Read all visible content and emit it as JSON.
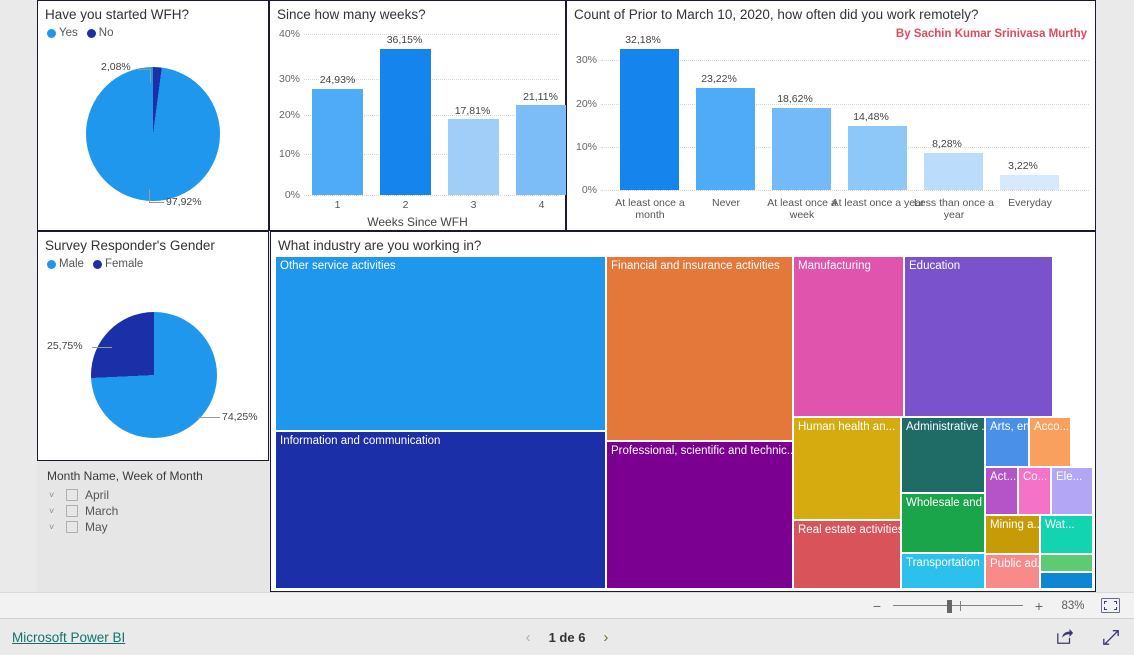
{
  "report": {
    "attribution": "By Sachin Kumar Srinivasa Murthy"
  },
  "panels": {
    "wfh_started": {
      "title": "Have you started WFH?"
    },
    "weeks": {
      "title": "Since how many weeks?"
    },
    "remote_freq": {
      "title": "Count of Prior to March 10, 2020, how often did you work remotely?"
    },
    "gender": {
      "title": "Survey Responder's Gender"
    },
    "industry": {
      "title": "What industry are you working in?"
    }
  },
  "slicer": {
    "title": "Month Name, Week of Month",
    "items": [
      {
        "label": "April",
        "checked": false
      },
      {
        "label": "March",
        "checked": false
      },
      {
        "label": "May",
        "checked": false
      }
    ]
  },
  "statusbar": {
    "minus": "−",
    "plus": "+",
    "zoom_level": "83%"
  },
  "footer": {
    "brand": "Microsoft Power BI",
    "prev": "‹",
    "next": "›",
    "page_label": "1 de 6"
  },
  "chart_data": [
    {
      "id": "wfh_started",
      "type": "pie",
      "title": "Have you started WFH?",
      "legend_position": "top-left",
      "labels": [
        "Yes",
        "No"
      ],
      "values": [
        97.92,
        2.08
      ],
      "value_labels": [
        "97,92%",
        "2,08%"
      ],
      "colors": [
        "#1f97ec",
        "#1b2fa8"
      ]
    },
    {
      "id": "weeks",
      "type": "bar",
      "title": "Since how many weeks?",
      "xlabel": "Weeks Since WFH",
      "ylabel": "",
      "categories": [
        "1",
        "2",
        "3",
        "4"
      ],
      "values": [
        24.93,
        36.15,
        17.81,
        21.11
      ],
      "value_labels": [
        "24,93%",
        "36,15%",
        "17,81%",
        "21,11%"
      ],
      "colors": [
        "#4fabf7",
        "#1684ed",
        "#a0cef9",
        "#7cbcf7"
      ],
      "ylim": [
        0,
        40
      ],
      "yticks": [
        "0%",
        "10%",
        "20%",
        "30%",
        "40%"
      ],
      "grid": true
    },
    {
      "id": "remote_freq",
      "type": "bar",
      "title": "Count of Prior to March 10, 2020, how often did you work remotely?",
      "xlabel": "",
      "ylabel": "",
      "categories": [
        "At least once a month",
        "Never",
        "At least once a week",
        "At least once a year",
        "Less than once a year",
        "Everyday"
      ],
      "values": [
        32.18,
        23.22,
        18.62,
        14.48,
        8.28,
        3.22
      ],
      "value_labels": [
        "32,18%",
        "23,22%",
        "18,62%",
        "14,48%",
        "8,28%",
        "3,22%"
      ],
      "colors": [
        "#1684ed",
        "#4fabf7",
        "#74baf8",
        "#8ec8f9",
        "#bcdcfb",
        "#d7eafc"
      ],
      "ylim": [
        0,
        35
      ],
      "yticks": [
        "0%",
        "10%",
        "20%",
        "30%"
      ],
      "grid": true
    },
    {
      "id": "gender",
      "type": "pie",
      "title": "Survey Responder's Gender",
      "legend_position": "top-left",
      "labels": [
        "Male",
        "Female"
      ],
      "values": [
        74.25,
        25.75
      ],
      "value_labels": [
        "74,25%",
        "25,75%"
      ],
      "colors": [
        "#1f97ec",
        "#1b2fa8"
      ]
    },
    {
      "id": "industry",
      "type": "treemap",
      "title": "What industry are you working in?",
      "tiles": [
        {
          "label": "Other service activities",
          "color": "#1f97ec"
        },
        {
          "label": "Information and communication",
          "color": "#1b2fa8"
        },
        {
          "label": "Financial and insurance activities",
          "color": "#e3783a"
        },
        {
          "label": "Professional, scientific and technic...",
          "color": "#7b0091"
        },
        {
          "label": "Manufacturing",
          "color": "#e054ad"
        },
        {
          "label": "Education",
          "color": "#7a52cb"
        },
        {
          "label": "Human health an...",
          "color": "#d5ab0f"
        },
        {
          "label": "Real estate activities",
          "color": "#d8535a"
        },
        {
          "label": "Administrative ...",
          "color": "#1f6b66"
        },
        {
          "label": "Wholesale and r...",
          "color": "#1aa54a"
        },
        {
          "label": "Transportation ...",
          "color": "#2cc0ec"
        },
        {
          "label": "Arts, en...",
          "color": "#4a90e8"
        },
        {
          "label": "Acco...",
          "color": "#f9a05e"
        },
        {
          "label": "Act...",
          "color": "#b454c8"
        },
        {
          "label": "Co...",
          "color": "#f472c8"
        },
        {
          "label": "Ele...",
          "color": "#b3a6f5"
        },
        {
          "label": "Mining a...",
          "color": "#c79a07"
        },
        {
          "label": "Wat...",
          "color": "#12d4b0"
        },
        {
          "label": "Public ad...",
          "color": "#f98a8a"
        },
        {
          "label": "",
          "color": "#5dcb72"
        },
        {
          "label": "",
          "color": "#0e86d4"
        }
      ]
    }
  ]
}
